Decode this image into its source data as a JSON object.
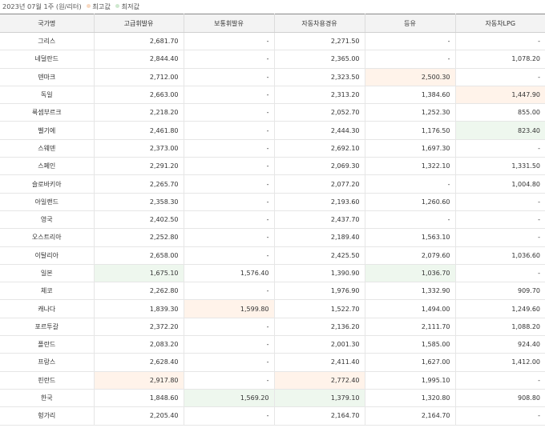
{
  "caption": {
    "period": "2023년 07월 1주",
    "unit": "(원/리터)",
    "legend_high": "최고값",
    "legend_low": "최저값",
    "colors": {
      "high": "#f8d9c2",
      "low": "#cfe8cf"
    }
  },
  "table": {
    "headers": [
      "국가명",
      "고급휘발유",
      "보통휘발유",
      "자동차용경유",
      "등유",
      "자동차LPG"
    ],
    "rows": [
      {
        "cells": [
          "그리스",
          "2,681.70",
          "-",
          "2,271.50",
          "-",
          "-"
        ],
        "marks": [
          "",
          "",
          "",
          "",
          "",
          ""
        ]
      },
      {
        "cells": [
          "네덜란드",
          "2,844.40",
          "-",
          "2,365.00",
          "-",
          "1,078.20"
        ],
        "marks": [
          "",
          "",
          "",
          "",
          "",
          ""
        ]
      },
      {
        "cells": [
          "덴마크",
          "2,712.00",
          "-",
          "2,323.50",
          "2,500.30",
          "-"
        ],
        "marks": [
          "",
          "",
          "",
          "",
          "high",
          ""
        ]
      },
      {
        "cells": [
          "독일",
          "2,663.00",
          "-",
          "2,313.20",
          "1,384.60",
          "1,447.90"
        ],
        "marks": [
          "",
          "",
          "",
          "",
          "",
          "high"
        ]
      },
      {
        "cells": [
          "룩셈부르크",
          "2,218.20",
          "-",
          "2,052.70",
          "1,252.30",
          "855.00"
        ],
        "marks": [
          "",
          "",
          "",
          "",
          "",
          ""
        ]
      },
      {
        "cells": [
          "벨기에",
          "2,461.80",
          "-",
          "2,444.30",
          "1,176.50",
          "823.40"
        ],
        "marks": [
          "",
          "",
          "",
          "",
          "",
          "low"
        ]
      },
      {
        "cells": [
          "스웨덴",
          "2,373.00",
          "-",
          "2,692.10",
          "1,697.30",
          "-"
        ],
        "marks": [
          "",
          "",
          "",
          "",
          "",
          ""
        ]
      },
      {
        "cells": [
          "스페인",
          "2,291.20",
          "-",
          "2,069.30",
          "1,322.10",
          "1,331.50"
        ],
        "marks": [
          "",
          "",
          "",
          "",
          "",
          ""
        ]
      },
      {
        "cells": [
          "슬로바키아",
          "2,265.70",
          "-",
          "2,077.20",
          "-",
          "1,004.80"
        ],
        "marks": [
          "",
          "",
          "",
          "",
          "",
          ""
        ]
      },
      {
        "cells": [
          "아일랜드",
          "2,358.30",
          "-",
          "2,193.60",
          "1,260.60",
          "-"
        ],
        "marks": [
          "",
          "",
          "",
          "",
          "",
          ""
        ]
      },
      {
        "cells": [
          "영국",
          "2,402.50",
          "-",
          "2,437.70",
          "-",
          "-"
        ],
        "marks": [
          "",
          "",
          "",
          "",
          "",
          ""
        ]
      },
      {
        "cells": [
          "오스트리아",
          "2,252.80",
          "-",
          "2,189.40",
          "1,563.10",
          "-"
        ],
        "marks": [
          "",
          "",
          "",
          "",
          "",
          ""
        ]
      },
      {
        "cells": [
          "이탈리아",
          "2,658.00",
          "-",
          "2,425.50",
          "2,079.60",
          "1,036.60"
        ],
        "marks": [
          "",
          "",
          "",
          "",
          "",
          ""
        ]
      },
      {
        "cells": [
          "일본",
          "1,675.10",
          "1,576.40",
          "1,390.90",
          "1,036.70",
          "-"
        ],
        "marks": [
          "",
          "low",
          "",
          "",
          "low",
          ""
        ]
      },
      {
        "cells": [
          "체코",
          "2,262.80",
          "-",
          "1,976.90",
          "1,332.90",
          "909.70"
        ],
        "marks": [
          "",
          "",
          "",
          "",
          "",
          ""
        ]
      },
      {
        "cells": [
          "캐나다",
          "1,839.30",
          "1,599.80",
          "1,522.70",
          "1,494.00",
          "1,249.60"
        ],
        "marks": [
          "",
          "",
          "high",
          "",
          "",
          ""
        ]
      },
      {
        "cells": [
          "포르투갈",
          "2,372.20",
          "-",
          "2,136.20",
          "2,111.70",
          "1,088.20"
        ],
        "marks": [
          "",
          "",
          "",
          "",
          "",
          ""
        ]
      },
      {
        "cells": [
          "폴란드",
          "2,083.20",
          "-",
          "2,001.30",
          "1,585.00",
          "924.40"
        ],
        "marks": [
          "",
          "",
          "",
          "",
          "",
          ""
        ]
      },
      {
        "cells": [
          "프랑스",
          "2,628.40",
          "-",
          "2,411.40",
          "1,627.00",
          "1,412.00"
        ],
        "marks": [
          "",
          "",
          "",
          "",
          "",
          ""
        ]
      },
      {
        "cells": [
          "핀란드",
          "2,917.80",
          "-",
          "2,772.40",
          "1,995.10",
          "-"
        ],
        "marks": [
          "",
          "high",
          "",
          "high",
          "",
          ""
        ]
      },
      {
        "cells": [
          "한국",
          "1,848.60",
          "1,569.20",
          "1,379.10",
          "1,320.80",
          "908.80"
        ],
        "marks": [
          "",
          "",
          "low",
          "low",
          "",
          ""
        ]
      },
      {
        "cells": [
          "헝가리",
          "2,205.40",
          "-",
          "2,164.70",
          "2,164.70",
          "-"
        ],
        "marks": [
          "",
          "",
          "",
          "",
          "",
          ""
        ]
      }
    ]
  }
}
